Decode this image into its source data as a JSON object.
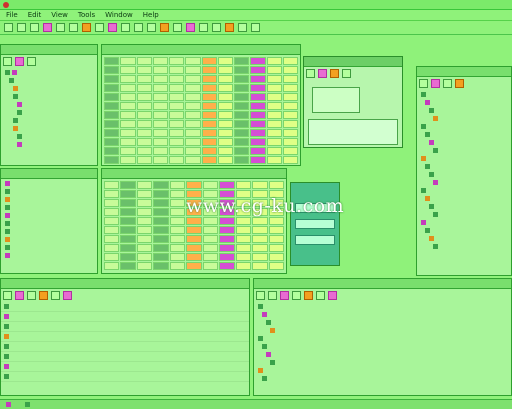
{
  "menu": {
    "items": [
      "File",
      "Edit",
      "View",
      "Tools",
      "Window",
      "Help"
    ]
  },
  "watermark": "www.cg-ku.com",
  "colors": {
    "bg": "#8ff27a",
    "accent": "#d54ed4",
    "warn": "#ffb04a"
  }
}
